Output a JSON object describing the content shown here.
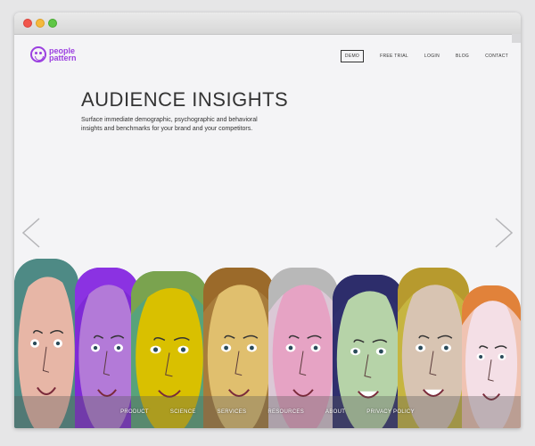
{
  "logo": {
    "line1": "people",
    "line2": "pattern",
    "brand_color": "#9b3fe0"
  },
  "nav": {
    "demo": "DEMO",
    "free_trial": "FREE TRIAL",
    "login": "LOGIN",
    "blog": "BLOG",
    "contact": "CONTACT"
  },
  "hero": {
    "title": "AUDIENCE INSIGHTS",
    "subtitle": "Surface immediate demographic, psychographic and behavioral insights and benchmarks for your brand and your competitors."
  },
  "carousel": {
    "prev_icon": "chevron-left-icon",
    "next_icon": "chevron-right-icon"
  },
  "faces": [
    {
      "bg": "#4e8a85",
      "skin": "#e7b6a6",
      "hair": "#4e8a85"
    },
    {
      "bg": "#7f2ad6",
      "skin": "#b37ad8",
      "hair": "#8b32e2"
    },
    {
      "bg": "#58a37a",
      "skin": "#d9c000",
      "hair": "#7aa34f"
    },
    {
      "bg": "#a77c3b",
      "skin": "#e0bf6e",
      "hair": "#9b6a2a"
    },
    {
      "bg": "#dbc8d6",
      "skin": "#e6a3c4",
      "hair": "#b8b8b8"
    },
    {
      "bg": "#2f2f6e",
      "skin": "#b6d3a8",
      "hair": "#2d2d6b"
    },
    {
      "bg": "#c6b540",
      "skin": "#d8c4b2",
      "hair": "#b79a2e"
    },
    {
      "bg": "#f0c3b2",
      "skin": "#f4dfe6",
      "hair": "#e1823a"
    }
  ],
  "footer": {
    "product": "PRODUCT",
    "science": "SCIENCE",
    "services": "SERVICES",
    "resources": "RESOURCES",
    "about": "ABOUT",
    "privacy": "PRIVACY POLICY"
  }
}
